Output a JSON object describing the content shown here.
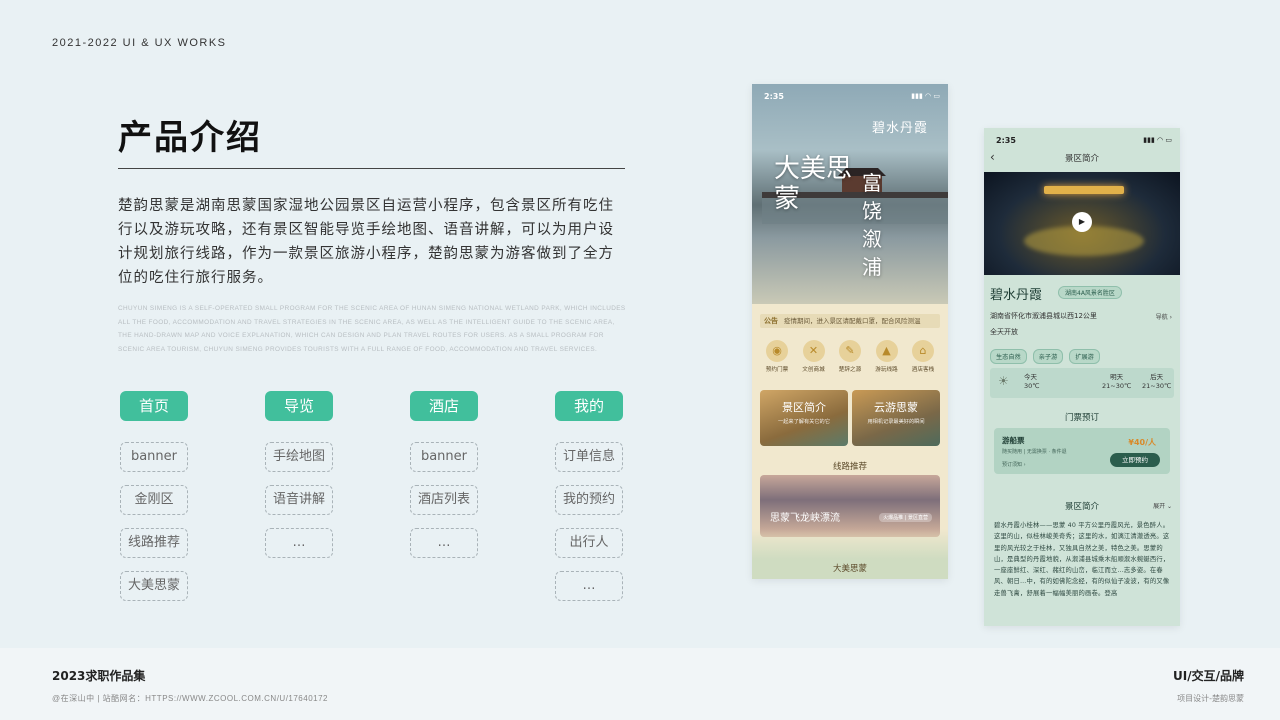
{
  "header": {
    "tag": "2021-2022 UI & UX WORKS"
  },
  "intro": {
    "title": "产品介绍",
    "description_cn": "楚韵思蒙是湖南思蒙国家湿地公园景区自运营小程序，包含景区所有吃住行以及游玩攻略，还有景区智能导览手绘地图、语音讲解，可以为用户设计规划旅行线路，作为一款景区旅游小程序，楚韵思蒙为游客做到了全方位的吃住行旅行服务。",
    "description_en": "CHUYUN SIMENG IS A SELF-OPERATED SMALL PROGRAM FOR THE SCENIC AREA OF HUNAN SIMENG NATIONAL WETLAND PARK, WHICH INCLUDES ALL THE FOOD, ACCOMMODATION AND TRAVEL STRATEGIES IN THE SCENIC AREA, AS WELL AS THE INTELLIGENT GUIDE TO THE SCENIC AREA, THE HAND-DRAWN MAP AND VOICE EXPLANATION, WHICH CAN DESIGN AND PLAN TRAVEL ROUTES FOR USERS. AS A SMALL PROGRAM FOR SCENIC AREA TOURISM, CHUYUN SIMENG PROVIDES TOURISTS WITH A FULL RANGE OF FOOD, ACCOMMODATION AND TRAVEL SERVICES."
  },
  "structure": [
    {
      "tab": "首页",
      "items": [
        "banner",
        "金刚区",
        "线路推荐",
        "大美思蒙"
      ]
    },
    {
      "tab": "导览",
      "items": [
        "手绘地图",
        "语音讲解",
        "…"
      ]
    },
    {
      "tab": "酒店",
      "items": [
        "banner",
        "酒店列表",
        "…"
      ]
    },
    {
      "tab": "我的",
      "items": [
        "订单信息",
        "我的预约",
        "出行人",
        "…"
      ]
    }
  ],
  "phone1": {
    "time": "2:35",
    "status_icons": "▮▮▮ ◠ ▭",
    "logo": "碧水丹霞",
    "calligraphy_main": "大美思蒙",
    "calligraphy_side": "富饶溆浦",
    "notice_label": "公告",
    "notice_text": "疫情期间，进入景区请配戴口罩，配合风险测温",
    "icons": [
      "预约门票",
      "文创商城",
      "楚辞之源",
      "游玩线路",
      "酒店客栈"
    ],
    "card1_title": "景区简介",
    "card1_sub": "一起来了解有关它的它",
    "card2_title": "云游思蒙",
    "card2_sub": "用相机记录最美好的瞬间",
    "route_section": "线路推荐",
    "route_title": "思蒙飞龙峡漂流",
    "route_tag": "火爆品推 | 景区直营",
    "bottom_section": "大美思蒙"
  },
  "phone2": {
    "time": "2:35",
    "status_icons": "▮▮▮ ◠ ▭",
    "nav_title": "景区简介",
    "back": "‹",
    "logo": "碧水丹霞",
    "badge": "湖南4A风景名胜区",
    "address": "湖南省怀化市溆浦县城以西12公里",
    "guide": "导航 ›",
    "open": "全天开放",
    "tags": [
      "生态自然",
      "亲子游",
      "扩展游"
    ],
    "weather": {
      "today_label": "今天",
      "today_temp": "30℃",
      "tomorrow_label": "明天",
      "tomorrow_temp": "21~30℃",
      "after_label": "后天",
      "after_temp": "21~30℃"
    },
    "ticket_section": "门票预订",
    "ticket_name": "游船票",
    "ticket_desc": "随买随用 | 无需换票 · 条件退",
    "ticket_note": "预订须知 ›",
    "ticket_price": "¥40/人",
    "ticket_button": "立即预约",
    "intro_section": "景区简介",
    "expand": "展开 ⌄",
    "intro_text": "碧水丹霞小桂林——思蒙 40 平方公里丹霞风光，景色醉人。这里的山，似桂林峻美奇秀；这里的水，如漓江清澈透亮。这里的风光较之于桂林，又独具自然之美，特色之美。思蒙的山，是典型的丹霞地貌，从溆浦县城乘木船顺溆水蜿蜒西行，一座座鲜红、深红、赭红的山峦，临江而立…志多姿。在春风、朝日…中，有的如佛陀念经，有的似仙子凌波，有的又像走兽飞禽，舒展着一幅幅美丽的画卷。登高"
  },
  "footer": {
    "left_title": "2023求职作品集",
    "left_sub": "@在深山中  |  站酷网名：HTTPS://WWW.ZCOOL.COM.CN/U/17640172",
    "right_title": "UI/交互/品牌",
    "right_sub": "项目设计-楚韵思蒙"
  },
  "colors": {
    "accent": "#41bf9c",
    "background": "#e9f1f4"
  }
}
